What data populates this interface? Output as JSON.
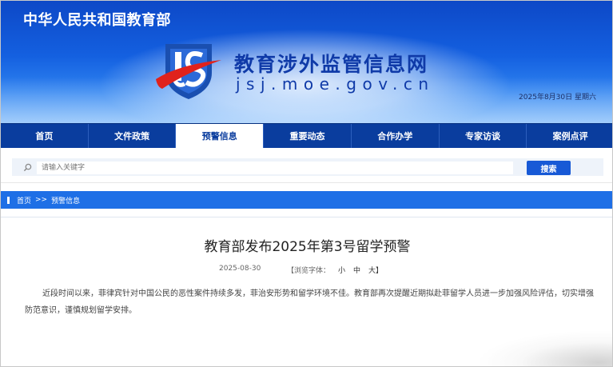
{
  "header": {
    "gov_name": "中华人民共和国教育部",
    "site_name": "教育涉外监管信息网",
    "site_domain": "jsj.moe.gov.cn",
    "date": "2025年8月30日  星期六",
    "colors": {
      "banner": "#1460e0",
      "nav": "#0a3d9e",
      "accent": "#1e6fe6"
    }
  },
  "nav": {
    "items": [
      {
        "label": "首页"
      },
      {
        "label": "文件政策"
      },
      {
        "label": "预警信息"
      },
      {
        "label": "重要动态"
      },
      {
        "label": "合作办学"
      },
      {
        "label": "专家访谈"
      },
      {
        "label": "案例点评"
      }
    ],
    "active_index": 2
  },
  "search": {
    "placeholder": "请输入关键字",
    "button_label": "搜索",
    "icon": "search-icon"
  },
  "breadcrumb": {
    "home": "首页",
    "separator": ">>",
    "current": "预警信息"
  },
  "article": {
    "title": "教育部发布2025年第3号留学预警",
    "date": "2025-08-30",
    "font_label": "【浏览字体：",
    "font_small": "小",
    "font_medium": "中",
    "font_large": "大】",
    "body": "近段时间以来，菲律宾针对中国公民的恶性案件持续多发，菲治安形势和留学环境不佳。教育部再次提醒近期拟赴菲留学人员进一步加强风险评估，切实增强防范意识，谨慎规划留学安排。"
  }
}
